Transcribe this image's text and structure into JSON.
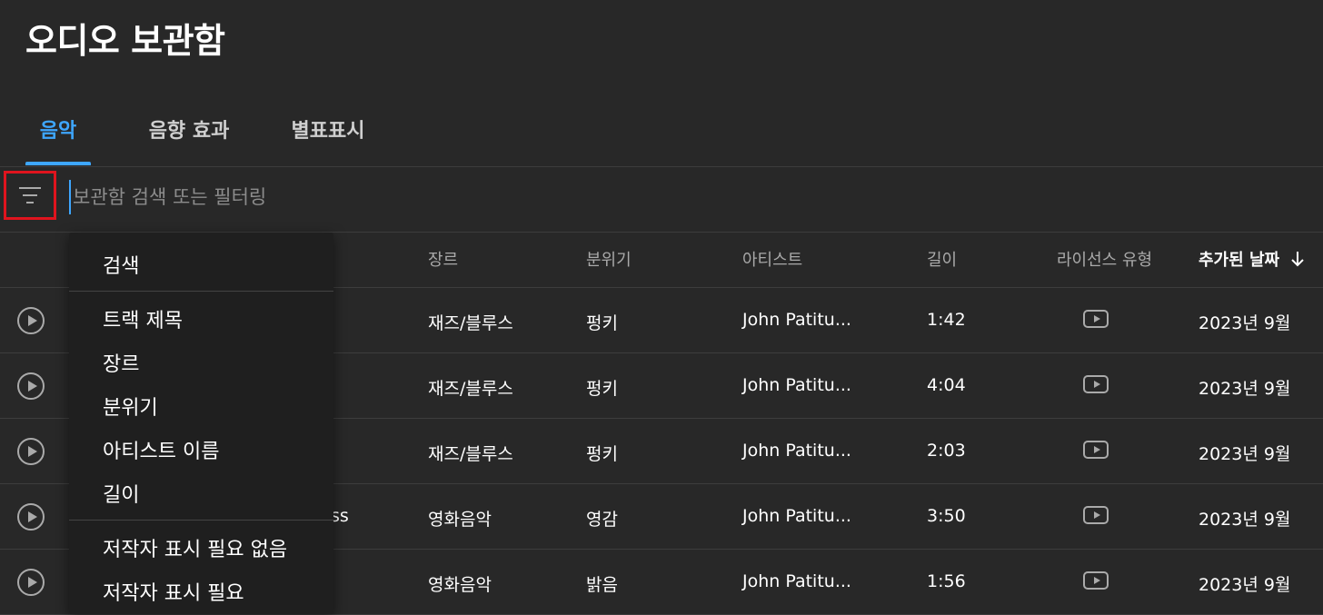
{
  "page": {
    "title": "오디오 보관함"
  },
  "tabs": [
    {
      "label": "음악",
      "active": true
    },
    {
      "label": "음향 효과",
      "active": false
    },
    {
      "label": "별표표시",
      "active": false
    }
  ],
  "search": {
    "placeholder": "보관함 검색 또는 필터링",
    "value": ""
  },
  "table": {
    "columns": {
      "genre": "장르",
      "mood": "분위기",
      "artist": "아티스트",
      "duration": "길이",
      "license": "라이선스 유형",
      "date_added": "추가된 날짜"
    },
    "sort_icon": "arrow-down-icon",
    "rows": [
      {
        "title": "",
        "genre": "재즈/블루스",
        "mood": "펑키",
        "artist": "John Patitu...",
        "duration": "1:42",
        "license_icon": "youtube-icon",
        "date_added": "2023년 9월"
      },
      {
        "title": "",
        "genre": "재즈/블루스",
        "mood": "펑키",
        "artist": "John Patitu...",
        "duration": "4:04",
        "license_icon": "youtube-icon",
        "date_added": "2023년 9월"
      },
      {
        "title": "",
        "genre": "재즈/블루스",
        "mood": "펑키",
        "artist": "John Patitu...",
        "duration": "2:03",
        "license_icon": "youtube-icon",
        "date_added": "2023년 9월"
      },
      {
        "title": "ss",
        "genre": "영화음악",
        "mood": "영감",
        "artist": "John Patitu...",
        "duration": "3:50",
        "license_icon": "youtube-icon",
        "date_added": "2023년 9월"
      },
      {
        "title": "",
        "genre": "영화음악",
        "mood": "밝음",
        "artist": "John Patitu...",
        "duration": "1:56",
        "license_icon": "youtube-icon",
        "date_added": "2023년 9월"
      }
    ]
  },
  "filter_menu": {
    "groups": [
      [
        "검색"
      ],
      [
        "트랙 제목",
        "장르",
        "분위기",
        "아티스트 이름",
        "길이"
      ],
      [
        "저작자 표시 필요 없음",
        "저작자 표시 필요"
      ]
    ]
  },
  "colors": {
    "background": "#282828",
    "accent": "#3ea6ff",
    "highlight": "#e0141e",
    "menu": "#1f1f1f"
  }
}
